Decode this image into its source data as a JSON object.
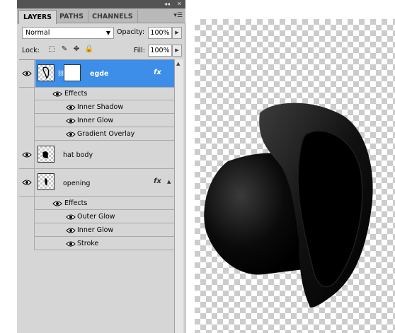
{
  "panel": {
    "tabs": [
      {
        "label": "LAYERS",
        "active": true
      },
      {
        "label": "PATHS",
        "active": false
      },
      {
        "label": "CHANNELS",
        "active": false
      }
    ],
    "blend_mode": "Normal",
    "opacity_label": "Opacity:",
    "opacity_value": "100%",
    "lock_label": "Lock:",
    "fill_label": "Fill:",
    "fill_value": "100%",
    "lock_icons": [
      "lock-transparent-pixels-icon",
      "lock-image-pixels-icon",
      "lock-position-icon",
      "lock-all-icon"
    ]
  },
  "layers": [
    {
      "name": "egde",
      "selected": true,
      "has_fx": true,
      "has_mask": true,
      "effects_label": "Effects",
      "effects": [
        "Inner Shadow",
        "Inner Glow",
        "Gradient Overlay"
      ]
    },
    {
      "name": "hat body",
      "selected": false,
      "has_fx": false
    },
    {
      "name": "opening",
      "selected": false,
      "has_fx": true,
      "effects_label": "Effects",
      "effects": [
        "Outer Glow",
        "Inner Glow",
        "Stroke"
      ]
    }
  ],
  "fx_label": "fx",
  "colors": {
    "selection": "#3d8ee8",
    "panel_bg": "#d6d6d6",
    "hat": "#000000"
  }
}
